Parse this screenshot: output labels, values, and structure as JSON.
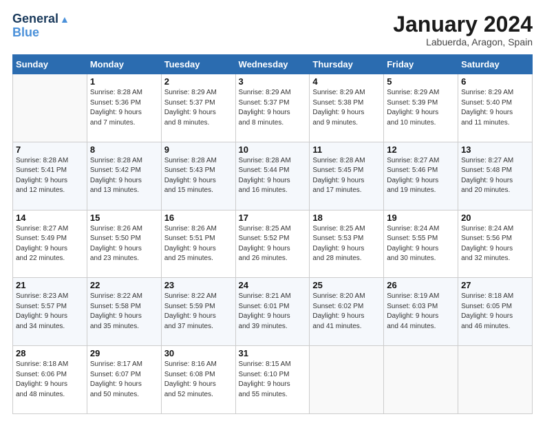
{
  "header": {
    "logo_line1": "General",
    "logo_line2": "Blue",
    "title": "January 2024",
    "subtitle": "Labuerda, Aragon, Spain"
  },
  "days_of_week": [
    "Sunday",
    "Monday",
    "Tuesday",
    "Wednesday",
    "Thursday",
    "Friday",
    "Saturday"
  ],
  "weeks": [
    [
      {
        "day": "",
        "info": ""
      },
      {
        "day": "1",
        "info": "Sunrise: 8:28 AM\nSunset: 5:36 PM\nDaylight: 9 hours\nand 7 minutes."
      },
      {
        "day": "2",
        "info": "Sunrise: 8:29 AM\nSunset: 5:37 PM\nDaylight: 9 hours\nand 8 minutes."
      },
      {
        "day": "3",
        "info": "Sunrise: 8:29 AM\nSunset: 5:37 PM\nDaylight: 9 hours\nand 8 minutes."
      },
      {
        "day": "4",
        "info": "Sunrise: 8:29 AM\nSunset: 5:38 PM\nDaylight: 9 hours\nand 9 minutes."
      },
      {
        "day": "5",
        "info": "Sunrise: 8:29 AM\nSunset: 5:39 PM\nDaylight: 9 hours\nand 10 minutes."
      },
      {
        "day": "6",
        "info": "Sunrise: 8:29 AM\nSunset: 5:40 PM\nDaylight: 9 hours\nand 11 minutes."
      }
    ],
    [
      {
        "day": "7",
        "info": "Sunrise: 8:28 AM\nSunset: 5:41 PM\nDaylight: 9 hours\nand 12 minutes."
      },
      {
        "day": "8",
        "info": "Sunrise: 8:28 AM\nSunset: 5:42 PM\nDaylight: 9 hours\nand 13 minutes."
      },
      {
        "day": "9",
        "info": "Sunrise: 8:28 AM\nSunset: 5:43 PM\nDaylight: 9 hours\nand 15 minutes."
      },
      {
        "day": "10",
        "info": "Sunrise: 8:28 AM\nSunset: 5:44 PM\nDaylight: 9 hours\nand 16 minutes."
      },
      {
        "day": "11",
        "info": "Sunrise: 8:28 AM\nSunset: 5:45 PM\nDaylight: 9 hours\nand 17 minutes."
      },
      {
        "day": "12",
        "info": "Sunrise: 8:27 AM\nSunset: 5:46 PM\nDaylight: 9 hours\nand 19 minutes."
      },
      {
        "day": "13",
        "info": "Sunrise: 8:27 AM\nSunset: 5:48 PM\nDaylight: 9 hours\nand 20 minutes."
      }
    ],
    [
      {
        "day": "14",
        "info": "Sunrise: 8:27 AM\nSunset: 5:49 PM\nDaylight: 9 hours\nand 22 minutes."
      },
      {
        "day": "15",
        "info": "Sunrise: 8:26 AM\nSunset: 5:50 PM\nDaylight: 9 hours\nand 23 minutes."
      },
      {
        "day": "16",
        "info": "Sunrise: 8:26 AM\nSunset: 5:51 PM\nDaylight: 9 hours\nand 25 minutes."
      },
      {
        "day": "17",
        "info": "Sunrise: 8:25 AM\nSunset: 5:52 PM\nDaylight: 9 hours\nand 26 minutes."
      },
      {
        "day": "18",
        "info": "Sunrise: 8:25 AM\nSunset: 5:53 PM\nDaylight: 9 hours\nand 28 minutes."
      },
      {
        "day": "19",
        "info": "Sunrise: 8:24 AM\nSunset: 5:55 PM\nDaylight: 9 hours\nand 30 minutes."
      },
      {
        "day": "20",
        "info": "Sunrise: 8:24 AM\nSunset: 5:56 PM\nDaylight: 9 hours\nand 32 minutes."
      }
    ],
    [
      {
        "day": "21",
        "info": "Sunrise: 8:23 AM\nSunset: 5:57 PM\nDaylight: 9 hours\nand 34 minutes."
      },
      {
        "day": "22",
        "info": "Sunrise: 8:22 AM\nSunset: 5:58 PM\nDaylight: 9 hours\nand 35 minutes."
      },
      {
        "day": "23",
        "info": "Sunrise: 8:22 AM\nSunset: 5:59 PM\nDaylight: 9 hours\nand 37 minutes."
      },
      {
        "day": "24",
        "info": "Sunrise: 8:21 AM\nSunset: 6:01 PM\nDaylight: 9 hours\nand 39 minutes."
      },
      {
        "day": "25",
        "info": "Sunrise: 8:20 AM\nSunset: 6:02 PM\nDaylight: 9 hours\nand 41 minutes."
      },
      {
        "day": "26",
        "info": "Sunrise: 8:19 AM\nSunset: 6:03 PM\nDaylight: 9 hours\nand 44 minutes."
      },
      {
        "day": "27",
        "info": "Sunrise: 8:18 AM\nSunset: 6:05 PM\nDaylight: 9 hours\nand 46 minutes."
      }
    ],
    [
      {
        "day": "28",
        "info": "Sunrise: 8:18 AM\nSunset: 6:06 PM\nDaylight: 9 hours\nand 48 minutes."
      },
      {
        "day": "29",
        "info": "Sunrise: 8:17 AM\nSunset: 6:07 PM\nDaylight: 9 hours\nand 50 minutes."
      },
      {
        "day": "30",
        "info": "Sunrise: 8:16 AM\nSunset: 6:08 PM\nDaylight: 9 hours\nand 52 minutes."
      },
      {
        "day": "31",
        "info": "Sunrise: 8:15 AM\nSunset: 6:10 PM\nDaylight: 9 hours\nand 55 minutes."
      },
      {
        "day": "",
        "info": ""
      },
      {
        "day": "",
        "info": ""
      },
      {
        "day": "",
        "info": ""
      }
    ]
  ]
}
